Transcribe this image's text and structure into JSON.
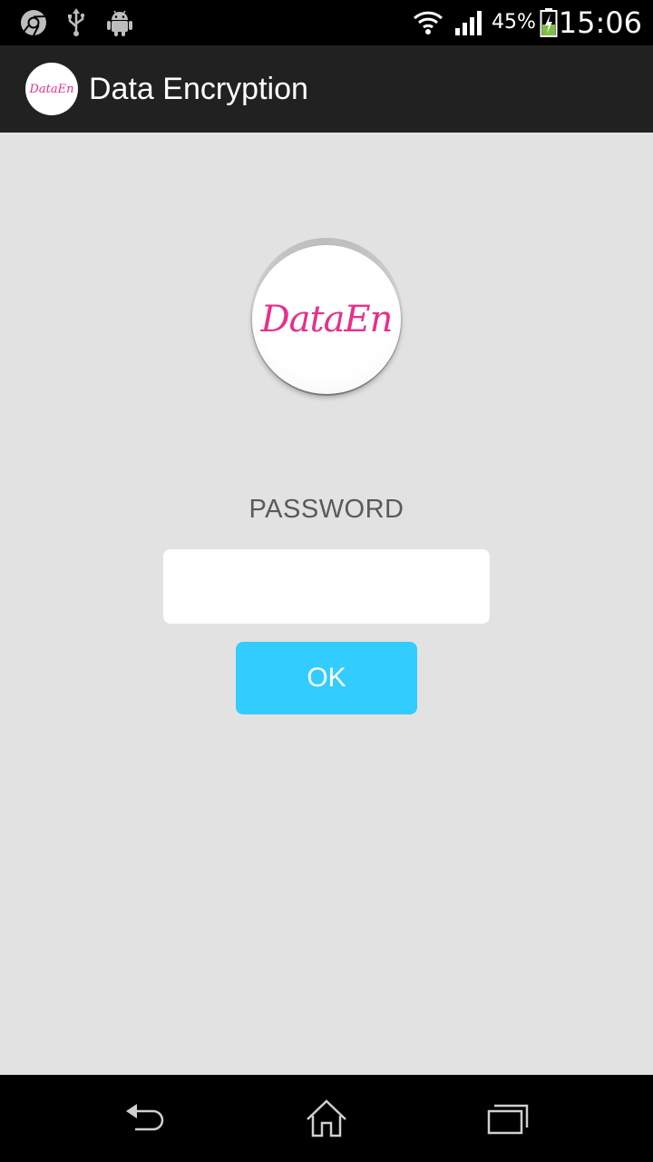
{
  "status_bar": {
    "battery_percent": "45%",
    "time": "15:06",
    "icons": [
      "chrome-icon",
      "usb-icon",
      "android-icon",
      "wifi-icon",
      "signal-icon",
      "battery-charging-icon"
    ]
  },
  "action_bar": {
    "logo_text": "DataEn",
    "title": "Data Encryption"
  },
  "main": {
    "logo_text": "DataEn",
    "password_label": "PASSWORD",
    "password_value": "",
    "ok_label": "OK"
  },
  "nav_bar": {
    "icons": [
      "back-icon",
      "home-icon",
      "recents-icon"
    ]
  },
  "colors": {
    "background": "#e2e2e2",
    "action_bar": "#212121",
    "accent_button": "#33ccff",
    "logo_text": "#e8308a"
  }
}
